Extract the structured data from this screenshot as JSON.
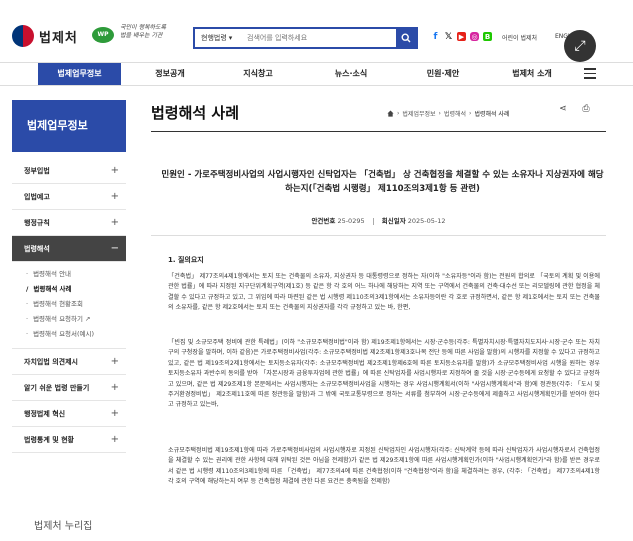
{
  "header": {
    "logo_text": "법제처",
    "badge": "WP",
    "slogan": "국민이 행복하도록 법을 배우는 기관",
    "search": {
      "scope": "현행법령",
      "placeholder": "검색어를 입력하세요"
    },
    "utility_links": [
      "어린이 법제처",
      "ENGLISH"
    ],
    "colors": {
      "brand": "#2b4ba8",
      "dark": "#444444"
    }
  },
  "nav": {
    "items": [
      "법제업무정보",
      "정보공개",
      "지식창고",
      "뉴스·소식",
      "민원·제안",
      "법제처 소개"
    ]
  },
  "sidebar": {
    "title": "법제업무정보",
    "items": [
      {
        "label": "정부입법",
        "toggle": "+"
      },
      {
        "label": "입법예고",
        "toggle": "+"
      },
      {
        "label": "행정규칙",
        "toggle": "+"
      },
      {
        "label": "법령해석",
        "toggle": "−"
      },
      {
        "label": "자치입법 의견제시",
        "toggle": "+"
      },
      {
        "label": "알기 쉬운 법령 만들기",
        "toggle": "+"
      },
      {
        "label": "행정법제 혁신",
        "toggle": "+"
      },
      {
        "label": "법령통계 및 현황",
        "toggle": "+"
      }
    ],
    "subitems": [
      {
        "label": "법령해석 안내"
      },
      {
        "label": "법령해석 사례"
      },
      {
        "label": "법령해석 현황조회"
      },
      {
        "label": "법령해석 요청하기 ↗"
      },
      {
        "label": "법령해석 요청서(예시)"
      }
    ],
    "footer": "법제처 누리집"
  },
  "main": {
    "title": "법령해석 사례",
    "breadcrumb": [
      "법제업무정보",
      "법령해석",
      "법령해석 사례"
    ],
    "case_title": "민원인 - 가로주택정비사업의 사업시행자인 신탁업자는 「건축법」 상 건축협정을 체결할 수 있는 소유자나 지상권자에 해당하는지(「건축법 시행령」 제110조의3제1항 등 관련)",
    "meta": {
      "case_no_label": "안건번호",
      "case_no": "25-0295",
      "date_label": "회신일자",
      "date": "2025-05-12"
    },
    "section_heading": "1. 질의요지",
    "paragraphs": [
      "「건축법」 제77조의4제1항에서는 토지 또는 건축물의 소유자, 지상권자 등 대통령령으로 정하는 자(이하 \"소유자등\"이라 함)는 전원의 합의로 「국토의 계획 및 이용에 관한 법률」에 따라 지정된 지구단위계획구역(제1호) 등 같은 항 각 호의 어느 하나에 해당하는 지역 또는 구역에서 건축물의 건축·대수선 또는 리모델링에 관한 협정을 체결할 수 있다고 규정하고 있고, 그 위임에 따라 마련된 같은 법 시행령 제110조의3제1항에서는 소유자등이란 각 호로 규정하면서, 같은 항 제1호에서는 토지 또는 건축물의 소유자를, 같은 항 제2호에서는 토지 또는 건축물의 지상권자를 각각 규정하고 있는 바, 한편,",
      "「빈집 및 소규모주택 정비에 관한 특례법」(이하 \"소규모주택정비법\"이라 함) 제19조제1항에서는 시장·군수등(각주: 특별자치시장·특별자치도지사·시장·군수 또는 자치구의 구청장을 말하며, 이하 같음)은 가로주택정비사업(각주: 소규모주택정비법 제2조제1항제3호나목 전단 등에 따른 사업을 말함)의 시행자를 지정할 수 있다고 규정하고 있고, 같은 법 제19조의2제1항에서는 토지등소유자(각주: 소규모주택정비법 제2조제1항제6호에 따른 토지등소유자를 말함)가 소규모주택정비사업 시행을 원하는 경우 토지등소유자 과반수의 동의를 받아 「자본시장과 금융투자업에 관한 법률」에 따른 신탁업자를 사업시행자로 지정하여 줄 것을 시장·군수등에게 요청할 수 있다고 규정하고 있으며, 같은 법 제29조제1항 본문에서는 사업시행자는 소규모주택정비사업을 시행하는 경우 사업시행계획서(이하 \"사업시행계획서\"라 함)에 정관등(각주: 「도시 및 주거환경정비법」 제2조제11호에 따른 정관등을 말함)과 그 밖에 국토교통부령으로 정하는 서류를 첨부하여 시장·군수등에게 제출하고 사업시행계획인가를 받아야 한다고 규정하고 있는바,",
      "소규모주택정비법 제19조제1항에 따라 가로주택정비사업의 사업시행자로 지정된 신탁업자인 사업시행자(각주: 신탁계약 등에 따라 신탁업자가 사업시행자로서 건축협정을 체결할 수 있는 권리에 관한 사항에 대해 위탁된 것은 아님을 전제함)가 같은 법 제29조제1항에 따른 사업시행계획인가(이하 \"사업시행계획인가\"라 함)를 받은 경우로서 같은 법 시행령 제110조의3제1항에 따른 「건축법」 제77조의4에 따른 건축협정(이하 \"건축협정\"이라 함)을 체결하려는 경우, (각주: 「건축법」 제77조의4제1항 각 호의 구역에 해당하는지 여부 등 건축협정 체결에 관한 다른 요건은 충족됨을 전제함)"
    ]
  }
}
